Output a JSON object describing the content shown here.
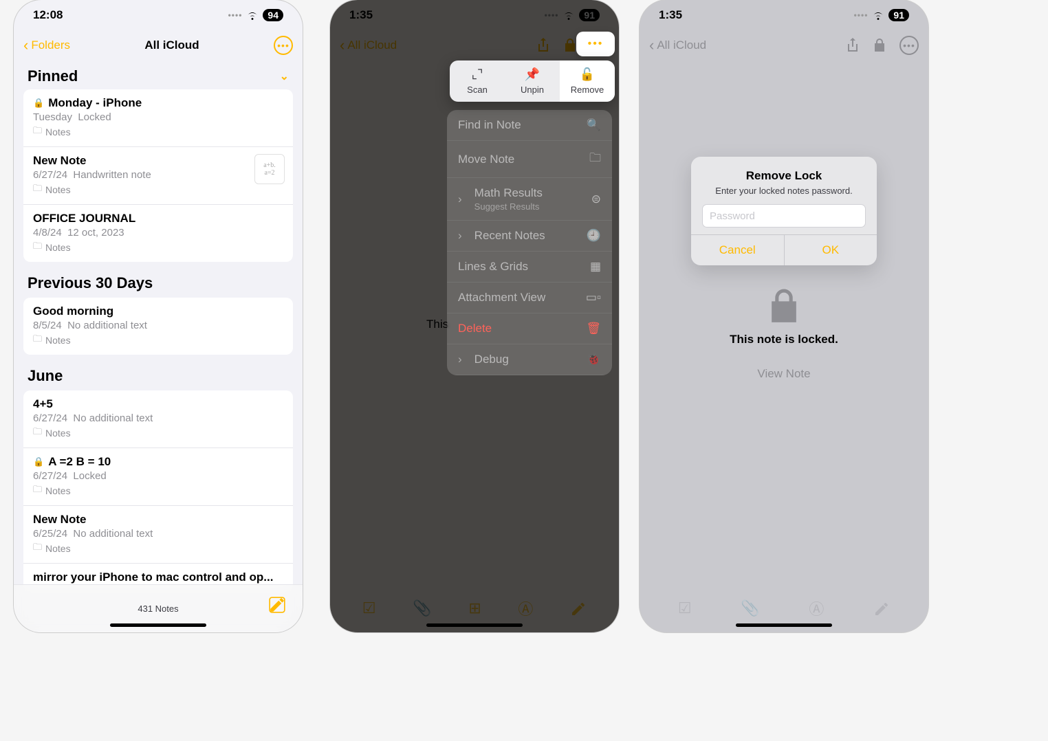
{
  "screen1": {
    "status": {
      "time": "12:08",
      "battery": "94"
    },
    "nav": {
      "back": "Folders",
      "title": "All iCloud"
    },
    "pinned_label": "Pinned",
    "sections": {
      "prev30": "Previous 30 Days",
      "june": "June"
    },
    "notes": {
      "pinned": [
        {
          "title": "Monday - iPhone",
          "date": "Tuesday",
          "extra": "Locked",
          "folder": "Notes",
          "locked": true
        },
        {
          "title": "New Note",
          "date": "6/27/24",
          "extra": "Handwritten note",
          "folder": "Notes",
          "thumb1": "a+b.",
          "thumb2": "a=2"
        },
        {
          "title": "OFFICE JOURNAL",
          "date": "4/8/24",
          "extra": "12 oct, 2023",
          "folder": "Notes"
        }
      ],
      "prev30": [
        {
          "title": "Good morning",
          "date": "8/5/24",
          "extra": "No additional text",
          "folder": "Notes"
        }
      ],
      "june": [
        {
          "title": "4+5",
          "date": "6/27/24",
          "extra": "No additional text",
          "folder": "Notes"
        },
        {
          "title": "A =2  B = 10",
          "date": "6/27/24",
          "extra": "Locked",
          "folder": "Notes",
          "locked": true
        },
        {
          "title": "New Note",
          "date": "6/25/24",
          "extra": "No additional text",
          "folder": "Notes"
        },
        {
          "title_trunc": "mirror your iPhone to mac control and op..."
        }
      ]
    },
    "toolbar_count": "431 Notes"
  },
  "screen2": {
    "status": {
      "time": "1:35",
      "battery": "91"
    },
    "nav_back": "All iCloud",
    "body_text": "This",
    "actions": {
      "scan": "Scan",
      "unpin": "Unpin",
      "remove": "Remove"
    },
    "menu": {
      "find": "Find in Note",
      "move": "Move Note",
      "math": "Math Results",
      "math_sub": "Suggest Results",
      "recent": "Recent Notes",
      "lines": "Lines & Grids",
      "attach": "Attachment View",
      "delete": "Delete",
      "debug": "Debug"
    }
  },
  "screen3": {
    "status": {
      "time": "1:35",
      "battery": "91"
    },
    "nav_back": "All iCloud",
    "locked_msg": "This note is locked.",
    "view_note": "View Note",
    "alert": {
      "title": "Remove Lock",
      "msg": "Enter your locked notes password.",
      "placeholder": "Password",
      "cancel": "Cancel",
      "ok": "OK"
    }
  }
}
